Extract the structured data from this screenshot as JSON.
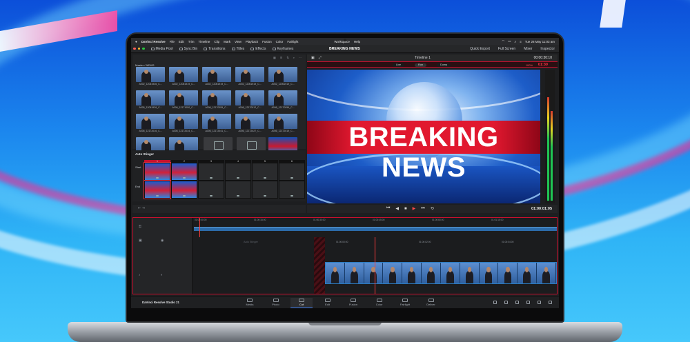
{
  "menubar": {
    "app": "DaVinci Resolve",
    "items": [
      "File",
      "Edit",
      "Trim",
      "Timeline",
      "Clip",
      "Mark",
      "View",
      "Playback",
      "Fusion",
      "Color",
      "Fairlight",
      "Workspace",
      "Help"
    ],
    "clock": "Tue 26 May  11:03 am"
  },
  "toolbar": {
    "media_pool": "Media Pool",
    "sync_bin": "Sync Bin",
    "transitions": "Transitions",
    "titles": "Titles",
    "effects": "Effects",
    "keyframes": "Keyframes",
    "project_title": "BREAKING NEWS",
    "quick_export": "Quick Export",
    "full_screen": "Full Screen",
    "mixer": "Mixer",
    "inspector": "Inspector"
  },
  "pool": {
    "breadcrumb": "Master / NEWS",
    "clips": [
      {
        "name": "A002_12061936_C...",
        "kind": "p"
      },
      {
        "name": "A002_12061919_C...",
        "kind": "p"
      },
      {
        "name": "A002_12061919_C...",
        "kind": "p"
      },
      {
        "name": "A002_12061919_C...",
        "kind": "p"
      },
      {
        "name": "A002_12061919_C...",
        "kind": "p"
      },
      {
        "name": "A005_12061936_C...",
        "kind": "p"
      },
      {
        "name": "A006_12171050_C...",
        "kind": "p"
      },
      {
        "name": "A006_12170055_C...",
        "kind": "p"
      },
      {
        "name": "A006_12170012_C...",
        "kind": "p"
      },
      {
        "name": "A006_12170056_C...",
        "kind": "p"
      },
      {
        "name": "A006_12172016_C...",
        "kind": "p"
      },
      {
        "name": "A006_12172034_C...",
        "kind": "p"
      },
      {
        "name": "A006_12172041_C...",
        "kind": "p"
      },
      {
        "name": "A006_12172027_C...",
        "kind": "p"
      },
      {
        "name": "A006_12172019_C...",
        "kind": "p"
      },
      {
        "name": "A006_12172039_C...",
        "kind": "p"
      },
      {
        "name": "A006_12172041_C...",
        "kind": "p"
      },
      {
        "name": "Timeline 1",
        "kind": "tl"
      },
      {
        "name": "Timeline 2",
        "kind": "tl"
      },
      {
        "name": "Stinger Breaking ...",
        "kind": "news"
      }
    ]
  },
  "stinger": {
    "title": "Auto Stinger",
    "start_label": "Start",
    "end_label": "End",
    "slots": [
      "1",
      "2",
      "3",
      "4",
      "5",
      "6"
    ]
  },
  "viewer": {
    "timeline_name": "Timeline 1",
    "timecode_top": "00:00:30:10",
    "headline": "BREAKING NEWS",
    "live_buttons": [
      "Live",
      "Run",
      "Dump"
    ],
    "record_level": "100%",
    "record_time": "01:30",
    "transport_time": "01:00:01:05"
  },
  "timeline": {
    "ruler": [
      "01:00:00:00",
      "01:00:15:00",
      "01:00:30:00",
      "01:00:45:00",
      "01:00:60:00",
      "01:01:15:00"
    ],
    "lower_ruler": [
      "01:00:00:00",
      "01:00:02:00",
      "01:00:04:00"
    ],
    "faded_label": "Auto Stinger"
  },
  "pages": {
    "brand": "DaVinci Resolve Studio 21",
    "items": [
      {
        "label": "Media",
        "active": false
      },
      {
        "label": "Photo",
        "active": false
      },
      {
        "label": "Cut",
        "active": true
      },
      {
        "label": "Edit",
        "active": false
      },
      {
        "label": "Fusion",
        "active": false
      },
      {
        "label": "Color",
        "active": false
      },
      {
        "label": "Fairlight",
        "active": false
      },
      {
        "label": "Deliver",
        "active": false
      }
    ]
  },
  "colors": {
    "accent_red": "#c8102e",
    "play": "#ff4a4a",
    "active_page": "#3d7df0"
  }
}
